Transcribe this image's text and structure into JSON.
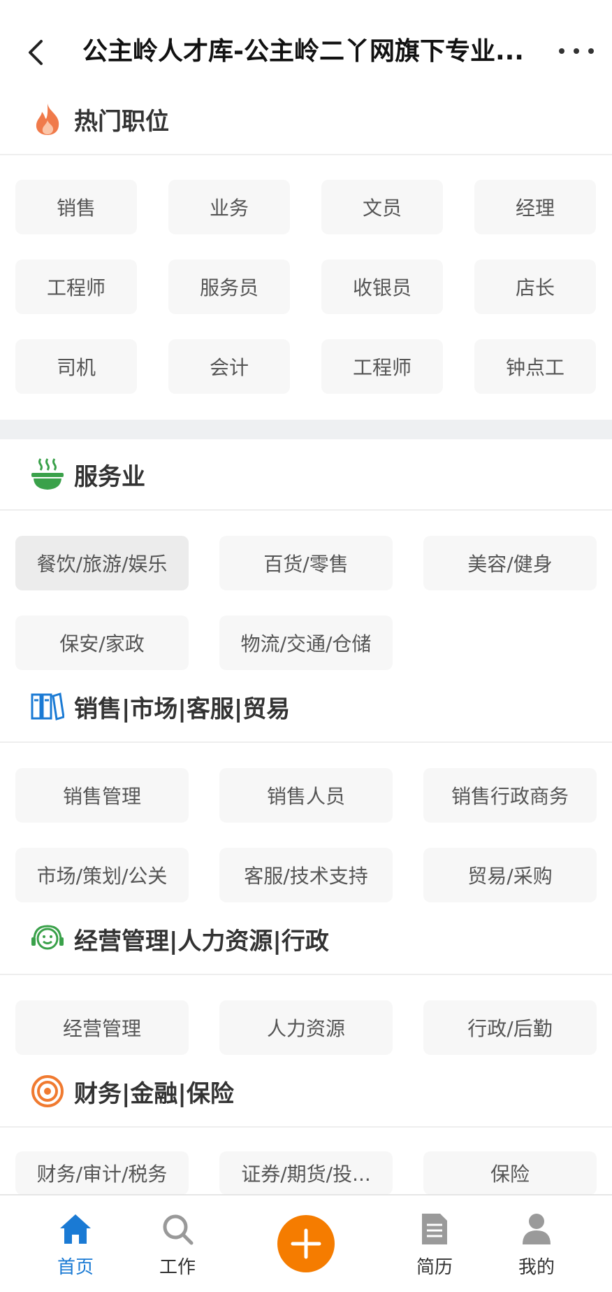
{
  "header": {
    "title": "公主岭人才库-公主岭二丫网旗下专业..."
  },
  "hot": {
    "title": "热门职位",
    "tags": [
      "销售",
      "业务",
      "文员",
      "经理",
      "工程师",
      "服务员",
      "收银员",
      "店长",
      "司机",
      "会计",
      "工程师",
      "钟点工"
    ]
  },
  "sections": [
    {
      "title": "服务业",
      "items": [
        "餐饮/旅游/娱乐",
        "百货/零售",
        "美容/健身",
        "保安/家政",
        "物流/交通/仓储"
      ]
    },
    {
      "title": "销售|市场|客服|贸易",
      "items": [
        "销售管理",
        "销售人员",
        "销售行政商务",
        "市场/策划/公关",
        "客服/技术支持",
        "贸易/采购"
      ]
    },
    {
      "title": "经营管理|人力资源|行政",
      "items": [
        "经营管理",
        "人力资源",
        "行政/后勤"
      ]
    },
    {
      "title": "财务|金融|保险",
      "items": [
        "财务/审计/税务",
        "证券/期货/投...",
        "保险"
      ]
    }
  ],
  "nav": {
    "home": "首页",
    "work": "工作",
    "resume": "简历",
    "mine": "我的"
  },
  "colors": {
    "accent": "#1a7ad4",
    "fab": "#f57c00",
    "fire": "#f07a4a",
    "green": "#3aa14a"
  },
  "icons": [
    "back-arrow-icon",
    "more-dots-icon",
    "fire-icon",
    "food-bowl-icon",
    "books-icon",
    "headset-icon",
    "target-icon",
    "home-icon",
    "search-icon",
    "plus-icon",
    "document-icon",
    "user-icon"
  ]
}
